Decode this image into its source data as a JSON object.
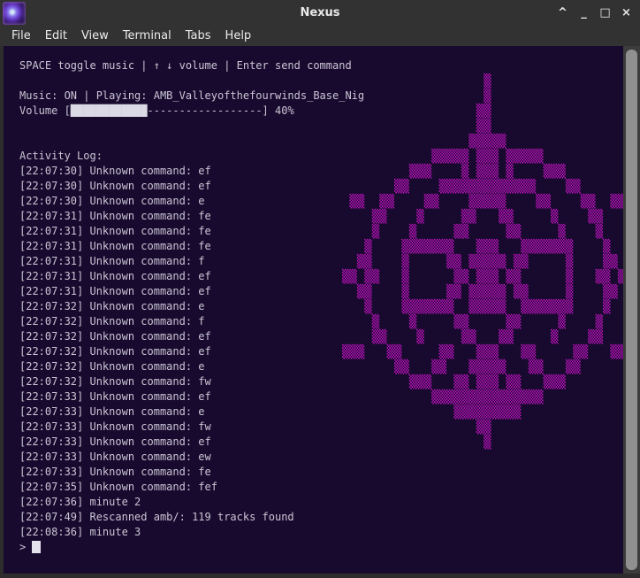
{
  "window": {
    "title": "Nexus",
    "controls": {
      "shade": "^",
      "minimize": "_",
      "maximize": "□",
      "close": "×"
    }
  },
  "menu": {
    "items": [
      "File",
      "Edit",
      "View",
      "Terminal",
      "Tabs",
      "Help"
    ]
  },
  "terminal": {
    "help_line": "SPACE toggle music | ↑ ↓ volume | Enter send command",
    "music_line": "Music: ON | Playing: AMB_Valleyofthefourwinds_Base_Nig",
    "volume": {
      "prefix": "Volume [",
      "filled": "████████████",
      "dashes": "------------------",
      "suffix": "] 40%",
      "percent": 40
    },
    "activity_log_title": "Activity Log:",
    "log": [
      "[22:07:30] Unknown command: ef",
      "[22:07:30] Unknown command: ef",
      "[22:07:30] Unknown command: e",
      "[22:07:31] Unknown command: fe",
      "[22:07:31] Unknown command: fe",
      "[22:07:31] Unknown command: fe",
      "[22:07:31] Unknown command: f",
      "[22:07:31] Unknown command: ef",
      "[22:07:31] Unknown command: ef",
      "[22:07:32] Unknown command: e",
      "[22:07:32] Unknown command: f",
      "[22:07:32] Unknown command: ef",
      "[22:07:32] Unknown command: ef",
      "[22:07:32] Unknown command: e",
      "[22:07:32] Unknown command: fw",
      "[22:07:33] Unknown command: ef",
      "[22:07:33] Unknown command: e",
      "[22:07:33] Unknown command: fw",
      "[22:07:33] Unknown command: ef",
      "[22:07:33] Unknown command: ew",
      "[22:07:33] Unknown command: fe",
      "[22:07:35] Unknown command: fef",
      "[22:07:36] minute 2",
      "[22:07:49] Rescanned amb/: 119 tracks found",
      "[22:08:36] minute 3"
    ],
    "prompt": "> "
  },
  "art": {
    "description": "magenta circular sigil drawn with medium-shade characters",
    "color": "#c414c4",
    "rows": [
      "                   ▒                   ",
      "                   ▒                   ",
      "                  ▒▒                   ",
      "                  ▒▒                   ",
      "                 ▒▒▒▒▒                 ",
      "            ▒▒▒▒▒ ▒▒▒ ▒▒▒▒▒            ",
      "         ▒▒▒    ▒ ▒▒▒ ▒    ▒▒▒         ",
      "       ▒▒    ▒▒▒▒▒▒▒▒▒▒▒▒▒    ▒▒       ",
      " ▒▒  ▒▒    ▒▒    ▒▒▒▒▒    ▒▒    ▒▒  ▒▒ ",
      "    ▒▒    ▒     ▒▒   ▒▒     ▒    ▒▒    ",
      "    ▒    ▒     ▒▒     ▒▒     ▒    ▒    ",
      "   ▒    ▒▒▒▒▒▒▒   ▒▒▒   ▒▒▒▒▒▒▒    ▒   ",
      "  ▒▒    ▒     ▒▒ ▒▒▒▒▒ ▒▒     ▒    ▒▒  ",
      "▒▒ ▒▒   ▒      ▒▒ ▒▒▒ ▒▒      ▒   ▒▒ ▒▒",
      "  ▒▒    ▒     ▒▒ ▒▒▒▒▒ ▒▒     ▒    ▒▒  ",
      "   ▒    ▒▒▒▒▒▒▒  ▒▒▒▒▒  ▒▒▒▒▒▒▒    ▒   ",
      "    ▒    ▒     ▒▒     ▒▒     ▒    ▒    ",
      "    ▒▒    ▒     ▒▒   ▒▒     ▒    ▒▒    ",
      "▒▒▒   ▒▒     ▒▒   ▒▒▒   ▒▒     ▒▒   ▒▒▒",
      "       ▒▒   ▒▒   ▒▒▒▒▒   ▒▒   ▒▒       ",
      "         ▒▒▒   ▒▒ ▒▒▒ ▒▒   ▒▒▒         ",
      "            ▒▒▒▒▒▒▒▒▒▒▒▒▒▒▒            ",
      "               ▒▒▒▒▒▒▒▒▒               ",
      "                  ▒▒                   ",
      "                   ▒                   "
    ]
  },
  "colors": {
    "chrome": "#323232",
    "terminal_bg": "#180a2e",
    "text": "#c9c5d4",
    "art_magenta": "#c414c4",
    "scrollbar_thumb": "#909090"
  }
}
